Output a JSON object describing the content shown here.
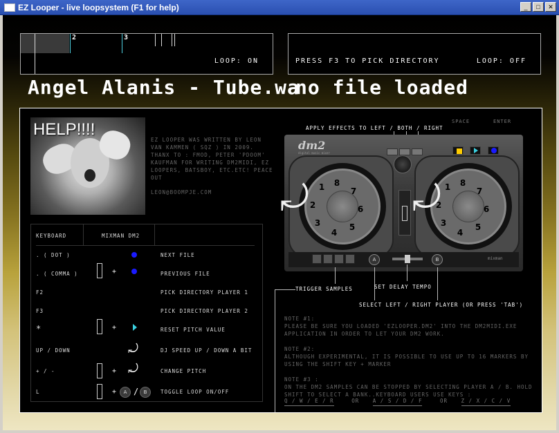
{
  "window": {
    "title": "EZ Looper - live loopsystem (F1 for help)",
    "buttons": {
      "minimize": "_",
      "maximize": "□",
      "close": "✕"
    }
  },
  "player_left": {
    "markers": [
      "2",
      "3"
    ],
    "loop_status": "LOOP: ON",
    "filename": "Angel Alanis - Tube.wa"
  },
  "player_right": {
    "prompt": "PRESS F3 TO PICK DIRECTORY",
    "loop_status": "LOOP: OFF",
    "filename": "no file loaded"
  },
  "help": {
    "image_caption": "HELP!!!!",
    "about_text": "EZ LOOPER WAS WRITTEN BY LEON VAN KAMMEN ( SQZ ) IN 2009. THANX TO : FMOD, PETER 'PDOOM' KAUFMAN FOR WRITING DM2MIDI, EZ LOOPERS, BATSBOY, ETC.ETC! PEACE OUT",
    "email": "LEON@BOOMPJE.COM"
  },
  "keytable": {
    "headers": {
      "keyboard": "KEYBOARD",
      "mixman": "MIXMAN DM2"
    },
    "rows": [
      {
        "key": ". ( DOT )",
        "desc": "NEXT FILE"
      },
      {
        "key": ". ( COMMA )",
        "desc": "PREVIOUS FILE"
      },
      {
        "key": "F2",
        "desc": "PICK DIRECTORY PLAYER 1"
      },
      {
        "key": "F3",
        "desc": "PICK DIRECTORY PLAYER 2"
      },
      {
        "key": "*",
        "desc": "RESET PITCH VALUE"
      },
      {
        "key": "UP / DOWN",
        "desc": "DJ SPEED UP / DOWN A BIT"
      },
      {
        "key": "+ / -",
        "desc": "CHANGE PITCH"
      },
      {
        "key": "L",
        "desc": "TOGGLE LOOP ON/OFF"
      }
    ],
    "plus": "+",
    "slash": "/",
    "btn_a": "A",
    "btn_b": "B"
  },
  "controller": {
    "apply_effects": "APPLY EFFECTS TO LEFT / BOTH / RIGHT",
    "space_label": "SPACE",
    "enter_label": "ENTER",
    "logo": "dm2",
    "logo_sub": "digital music mixer",
    "brand": "mixman",
    "wheel_numbers": [
      "1",
      "2",
      "3",
      "4",
      "5",
      "6",
      "7",
      "8"
    ],
    "btn_a": "A",
    "btn_b": "B",
    "trigger_samples": "TRIGGER SAMPLES",
    "set_delay_tempo": "SET DELAY TEMPO",
    "select_player": "SELECT LEFT / RIGHT PLAYER (OR PRESS 'TAB')"
  },
  "notes": {
    "note1_title": "NOTE #1:",
    "note1_text": "PLEASE BE SURE YOU LOADED 'EZLOOPER.DM2' INTO THE DM2MIDI.EXE APPLICATION IN ORDER TO LET YOUR DM2 WORK.",
    "note2_title": "NOTE #2:",
    "note2_text": "ALTHOUGH EXPERIMENTAL, IT IS POSSIBLE TO USE UP TO 16 MARKERS BY USING THE SHIFT KEY + MARKER",
    "note3_title": "NOTE #3 :",
    "note3_text": "ON THE DM2 SAMPLES CAN BE STOPPED BY SELECTING PLAYER A / B. HOLD SHIFT TO SELECT A BANK..KEYBOARD USERS USE KEYS :",
    "keys1": "Q / W / E / R",
    "or1": "OR",
    "keys2": "A / S / D / F",
    "or2": "OR",
    "keys3": "Z / X / C / V"
  },
  "colors": {
    "accent_cyan": "#3ad0e0",
    "accent_blue": "#1a1aff",
    "accent_yellow": "#ffcc00",
    "titlebar": "#2a4fb0"
  }
}
